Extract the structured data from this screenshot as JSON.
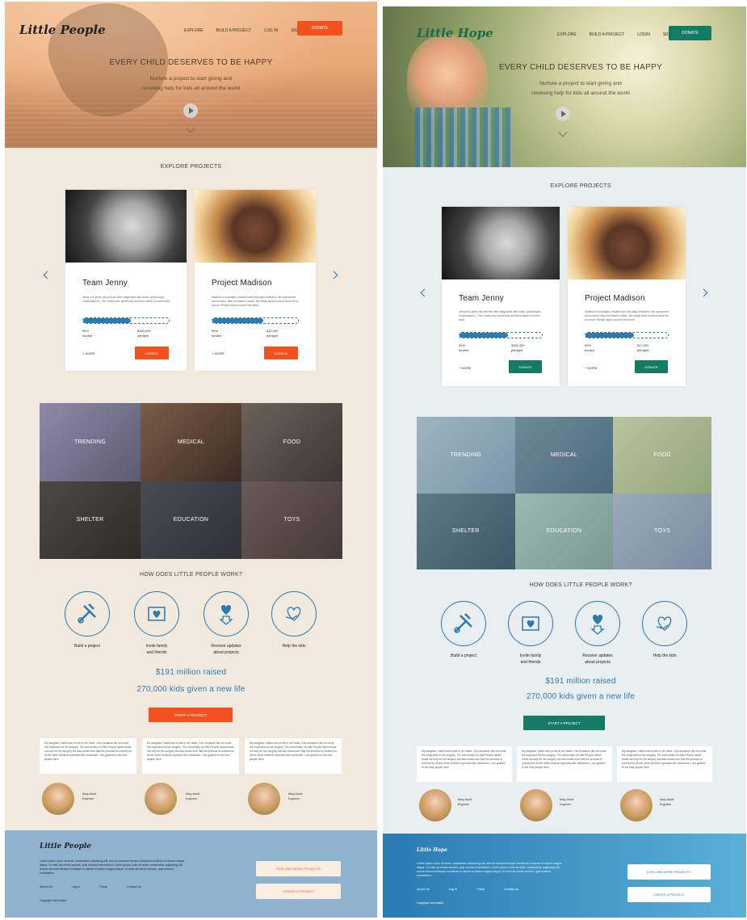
{
  "mock_a": {
    "logo": "Little People",
    "nav": [
      "EXPLORE",
      "BUILD A PROJECT",
      "LOG IN",
      "SIGN UP"
    ],
    "nav_donate": "DONATE",
    "hero_title": "EVERY CHILD DESERVES TO BE HAPPY",
    "hero_sub_1": "Nurture a project to start giving and",
    "hero_sub_2": "receiving help for kids all around the world",
    "explore_title": "EXPLORE PROJECTS",
    "cards": [
      {
        "title": "Team Jenny",
        "desc": "Jenny is 8 years old and has been diagnosed with Acute Lymphocytic Leukemia(ALL). She needs your generosity and kind wishes to move back.",
        "pct": "56%",
        "pct_label": "funded",
        "amount": "$300,000",
        "amount_label": "pledged",
        "progress": 0.56,
        "more": "+ MORE",
        "donate": "DONATE"
      },
      {
        "title": "Project Madison",
        "desc": "Madison is a straight A student and she plays football in her sophomore school team. After her father's death, her family lacks funds to send her to school. Please help to ensure her future.",
        "pct": "59%",
        "pct_label": "funded",
        "amount": "$12,000",
        "amount_label": "pledged",
        "progress": 0.59,
        "more": "+ MORE",
        "donate": "DONATE"
      }
    ],
    "categories": [
      "TRENDING",
      "MEDICAL",
      "FOOD",
      "SHELTER",
      "EDUCATION",
      "TOYS"
    ],
    "how_title": "HOW DOES LITTLE PEOPLE WORK?",
    "steps": [
      {
        "l1": "Build a project",
        "l2": ""
      },
      {
        "l1": "Invite family",
        "l2": "and friends"
      },
      {
        "l1": "Receive updates",
        "l2": "about projects"
      },
      {
        "l1": "Help the kids",
        "l2": ""
      }
    ],
    "raised": "$191 million raised",
    "kids": "270,000 kids given a new life",
    "start_btn": "START A PROJECT",
    "quote": "My daughter Caitlin had a hole in her heart. Our insurance did not cover the expenses for the surgery. The community of Little People raised funds not only for her surgery but also made sure that the process is covered for all the other medical expenses like medicines. I am grateful to the new people here.",
    "person_name": "Mary Alcott",
    "person_role": "Engineer",
    "footer_logo": "Little People",
    "footer_text": "Lorem ipsum dolor sit amet, consectetur adipiscing elit, sed do eiusmod tempor incididunt ut labore et dolore magna aliqua. Ut enim ad minim veniam, quis nostrud exercitation. Lorem ipsum dolor sit amet, consectetur adipiscing elit, sed do eiusmod tempor incididunt ut labore et dolore magna aliqua. Ut enim ad minim veniam, quis nostrud exercitation.",
    "footer_links": [
      "About Us",
      "Log In",
      "Press",
      "Contact us"
    ],
    "copyright": "Copyright information",
    "explore_more": "EXPLORE MORE PROJECTS",
    "create_project": "CREATE A PROJECT",
    "accent": "#f4511e"
  },
  "mock_b": {
    "logo": "Little Hope",
    "nav": [
      "EXPLORE",
      "BUILD A PROJECT",
      "LOGIN",
      "SIGN UP"
    ],
    "nav_donate": "DONATE",
    "hero_title": "EVERY CHILD DESERVES TO BE HAPPY",
    "hero_sub_1": "Nurture a project to start giving and",
    "hero_sub_2": "receiving help for kids all around the world",
    "explore_title": "EXPLORE PROJECTS",
    "cards": [
      {
        "title": "Team Jenny",
        "desc": "Jenny is 8 years old and has been diagnosed with Acute Lymphocytic Leukemia(ALL). She needs your generosity and kind wishes to move back.",
        "pct": "59%",
        "pct_label": "funded",
        "amount": "$300,000",
        "amount_label": "pledged",
        "progress": 0.59,
        "more": "+ MORE",
        "donate": "DONATE"
      },
      {
        "title": "Project Madison",
        "desc": "Madison is a straight A student and she plays football in her sophomore school team. After her father's death, her family lacks funds to send her to school. Please help to ensure her future.",
        "pct": "59%",
        "pct_label": "funded",
        "amount": "$12,000",
        "amount_label": "pledged",
        "progress": 0.59,
        "more": "+ MORE",
        "donate": "DONATE"
      }
    ],
    "categories": [
      "TRENDING",
      "MEDICAL",
      "FOOD",
      "SHELTER",
      "EDUCATION",
      "TOYS"
    ],
    "how_title": "HOW DOES LITTLE PEOPLE WORK?",
    "steps": [
      {
        "l1": "Build a project",
        "l2": ""
      },
      {
        "l1": "Invite family",
        "l2": "and friends"
      },
      {
        "l1": "Receive updates",
        "l2": "about projects"
      },
      {
        "l1": "Help the kids",
        "l2": ""
      }
    ],
    "raised": "$191 million raised",
    "kids": "270,000 kids given a new life",
    "start_btn": "START A PROJECT",
    "quote": "My daughter Caitlin had a hole in her heart. Our insurance did not cover the expenses for the surgery. The community of Little People raised funds not only for her surgery but also made sure that the process is covered for all the other medical expenses like medicines. I am grateful to the new people here.",
    "person_name": "Mary Alcott",
    "person_role": "Engineer",
    "footer_logo": "Little Hope",
    "footer_text": "Lorem ipsum dolor sit amet, consectetur adipiscing elit, sed do eiusmod tempor incididunt ut labore et dolore magna aliqua. Ut enim ad minim veniam, quis nostrud exercitation. Lorem ipsum dolor sit amet, consectetur adipiscing elit, sed do eiusmod tempor incididunt ut labore et dolore magna aliqua. Ut enim ad minim veniam, quis nostrud exercitation.",
    "footer_links": [
      "About Us",
      "Log In",
      "Press",
      "Contact us"
    ],
    "copyright": "Copyright information",
    "explore_more": "EXPLORE MORE PROJECTS",
    "create_project": "CREATE A PROJECT",
    "accent": "#137a63"
  }
}
